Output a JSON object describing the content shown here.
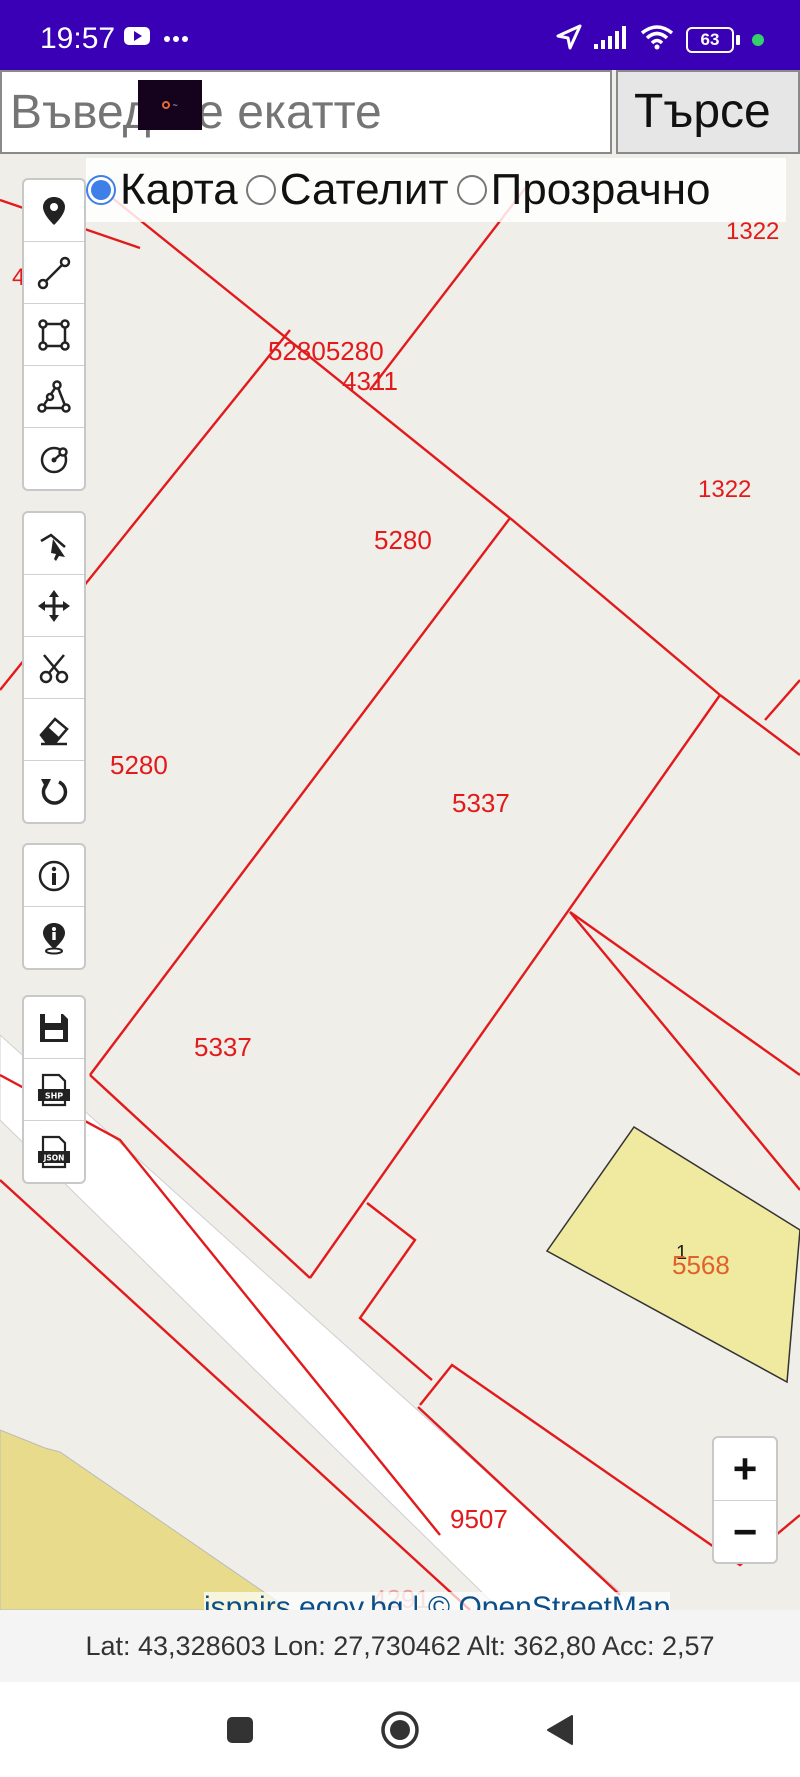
{
  "status_bar": {
    "time": "19:57",
    "battery_level": "63",
    "icons": [
      "youtube-icon",
      "more-dots-icon",
      "location-arrow-icon",
      "signal-icon",
      "wifi-icon",
      "battery-icon",
      "camera-dot-icon"
    ],
    "background_color": "#3a00b5"
  },
  "search": {
    "placeholder": "Въведете екатте",
    "button_label": "Търсе"
  },
  "layers": {
    "options": [
      {
        "label": "Карта",
        "selected": true
      },
      {
        "label": "Сателит",
        "selected": false
      },
      {
        "label": "Прозрачно",
        "selected": false
      }
    ]
  },
  "map": {
    "parcel_color": "#e31a1c",
    "building_fill": "#f0e9a0",
    "labels": [
      "4",
      "1322",
      "52805280",
      "4311",
      "1322",
      "5280",
      "5280",
      "5337",
      "5337",
      "1",
      "5568",
      "9507",
      "4291"
    ]
  },
  "toolbar": {
    "groups": [
      [
        "marker-icon",
        "polyline-icon",
        "rectangle-icon",
        "polygon-icon",
        "circle-icon"
      ],
      [
        "edit-vertex-icon",
        "move-icon",
        "cut-icon",
        "eraser-icon",
        "rotate-icon"
      ],
      [
        "info-icon",
        "point-info-icon"
      ],
      [
        "save-icon",
        "export-shp-icon",
        "export-json-icon"
      ]
    ],
    "shp_label": "SHP",
    "json_label": "JSON"
  },
  "zoom": {
    "in_label": "+",
    "out_label": "−"
  },
  "attribution": {
    "text": "ispnirs.egov.bg | © OpenStreetMap"
  },
  "coords": {
    "text": "Lat: 43,328603 Lon: 27,730462 Alt: 362,80 Acc: 2,57"
  },
  "nav": {
    "icons": [
      "recents-square-icon",
      "home-circle-icon",
      "back-triangle-icon"
    ]
  }
}
